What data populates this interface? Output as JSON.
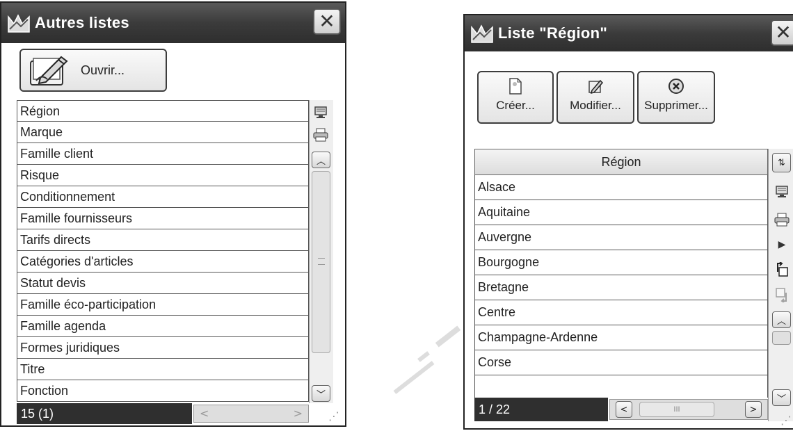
{
  "left_window": {
    "title": "Autres listes",
    "open_button": "Ouvrir...",
    "items": [
      "Région",
      "Marque",
      "Famille client",
      "Risque",
      "Conditionnement",
      "Famille fournisseurs",
      "Tarifs directs",
      "Catégories d'articles",
      "Statut devis",
      "Famille éco-participation",
      "Famille agenda",
      "Formes juridiques",
      "Titre",
      "Fonction"
    ],
    "status": "15 (1)"
  },
  "right_window": {
    "title": "Liste \"Région\"",
    "buttons": {
      "create": "Créer...",
      "modify": "Modifier...",
      "delete": "Supprimer..."
    },
    "column_header": "Région",
    "items": [
      "Alsace",
      "Aquitaine",
      "Auvergne",
      "Bourgogne",
      "Bretagne",
      "Centre",
      "Champagne-Ardenne",
      "Corse"
    ],
    "status": "1 / 22",
    "scroll_grip": "III"
  },
  "icons": {
    "close": "close-icon",
    "app": "app-logo-icon",
    "open": "edit-open-icon",
    "create": "new-document-icon",
    "modify": "edit-document-icon",
    "delete": "delete-circle-icon",
    "monitor": "monitor-icon",
    "printer": "printer-icon",
    "scroll_up": "chevron-up-icon",
    "scroll_down": "chevron-down-icon",
    "scroll_left": "chevron-left-icon",
    "scroll_right": "chevron-right-icon",
    "expand": "triangle-right-icon",
    "sort": "sort-columns-icon",
    "export": "export-icon",
    "import": "import-icon"
  }
}
